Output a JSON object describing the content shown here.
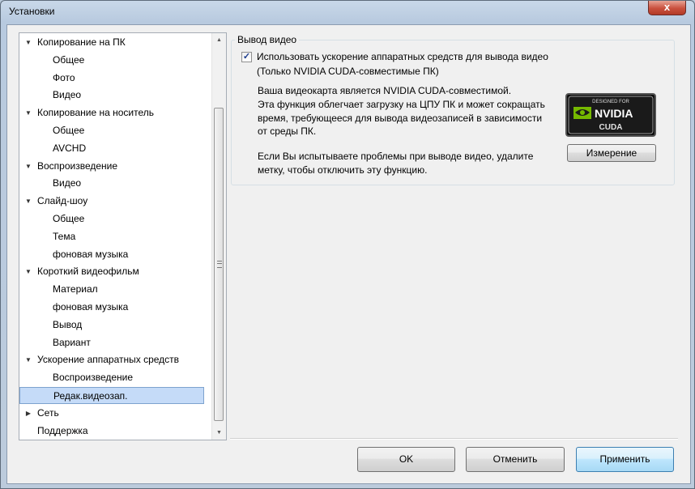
{
  "window": {
    "title": "Установки",
    "close_label": "x"
  },
  "tree": {
    "items": [
      {
        "label": "Копирование на ПК",
        "level": 1,
        "expander": "▼"
      },
      {
        "label": "Общее",
        "level": 2
      },
      {
        "label": "Фото",
        "level": 2
      },
      {
        "label": "Видео",
        "level": 2
      },
      {
        "label": "Копирование на носитель",
        "level": 1,
        "expander": "▼"
      },
      {
        "label": "Общее",
        "level": 2
      },
      {
        "label": "AVCHD",
        "level": 2
      },
      {
        "label": "Воспроизведение",
        "level": 1,
        "expander": "▼"
      },
      {
        "label": "Видео",
        "level": 2
      },
      {
        "label": "Слайд-шоу",
        "level": 1,
        "expander": "▼"
      },
      {
        "label": "Общее",
        "level": 2
      },
      {
        "label": "Тема",
        "level": 2
      },
      {
        "label": "фоновая музыка",
        "level": 2
      },
      {
        "label": "Короткий видеофильм",
        "level": 1,
        "expander": "▼"
      },
      {
        "label": "Материал",
        "level": 2
      },
      {
        "label": "фоновая музыка",
        "level": 2
      },
      {
        "label": "Вывод",
        "level": 2
      },
      {
        "label": "Вариант",
        "level": 2
      },
      {
        "label": "Ускорение аппаратных средств",
        "level": 1,
        "expander": "▼"
      },
      {
        "label": "Воспроизведение",
        "level": 2
      },
      {
        "label": "Редак.видеозап.",
        "level": 2,
        "selected": true
      },
      {
        "label": "Сеть",
        "level": 1,
        "expander": "▶"
      },
      {
        "label": "Поддержка",
        "level": 1
      }
    ],
    "scroll_up": "▲",
    "scroll_down": "▼"
  },
  "video_output": {
    "group_title": "Вывод видео",
    "checkbox_checked": true,
    "checkbox_mark": "✓",
    "checkbox_label": "Использовать ускорение аппаратных средств для вывода видео",
    "checkbox_sublabel": "(Только NVIDIA CUDA-совместимые ПК)",
    "info_lines": [
      "Ваша видеокарта является NVIDIA CUDA-совместимой.",
      "Эта функция облегчает загрузку на ЦПУ ПК и может сокращать",
      "время, требующееся для вывода видеозаписей в зависимости",
      "от среды ПК."
    ],
    "warning_lines": [
      "Если Вы испытываете проблемы при выводе видео, удалите",
      "метку, чтобы отключить эту функцию."
    ],
    "logo": {
      "top_text": "DESIGNED FOR",
      "brand": "NVIDIA",
      "sub": "CUDA"
    },
    "measure_button": "Измерение"
  },
  "footer": {
    "ok": "OK",
    "cancel": "Отменить",
    "apply": "Применить"
  },
  "colors": {
    "accent": "#3c7fb1",
    "selection": "#c5dbf8",
    "nvidia_green": "#76b900"
  }
}
